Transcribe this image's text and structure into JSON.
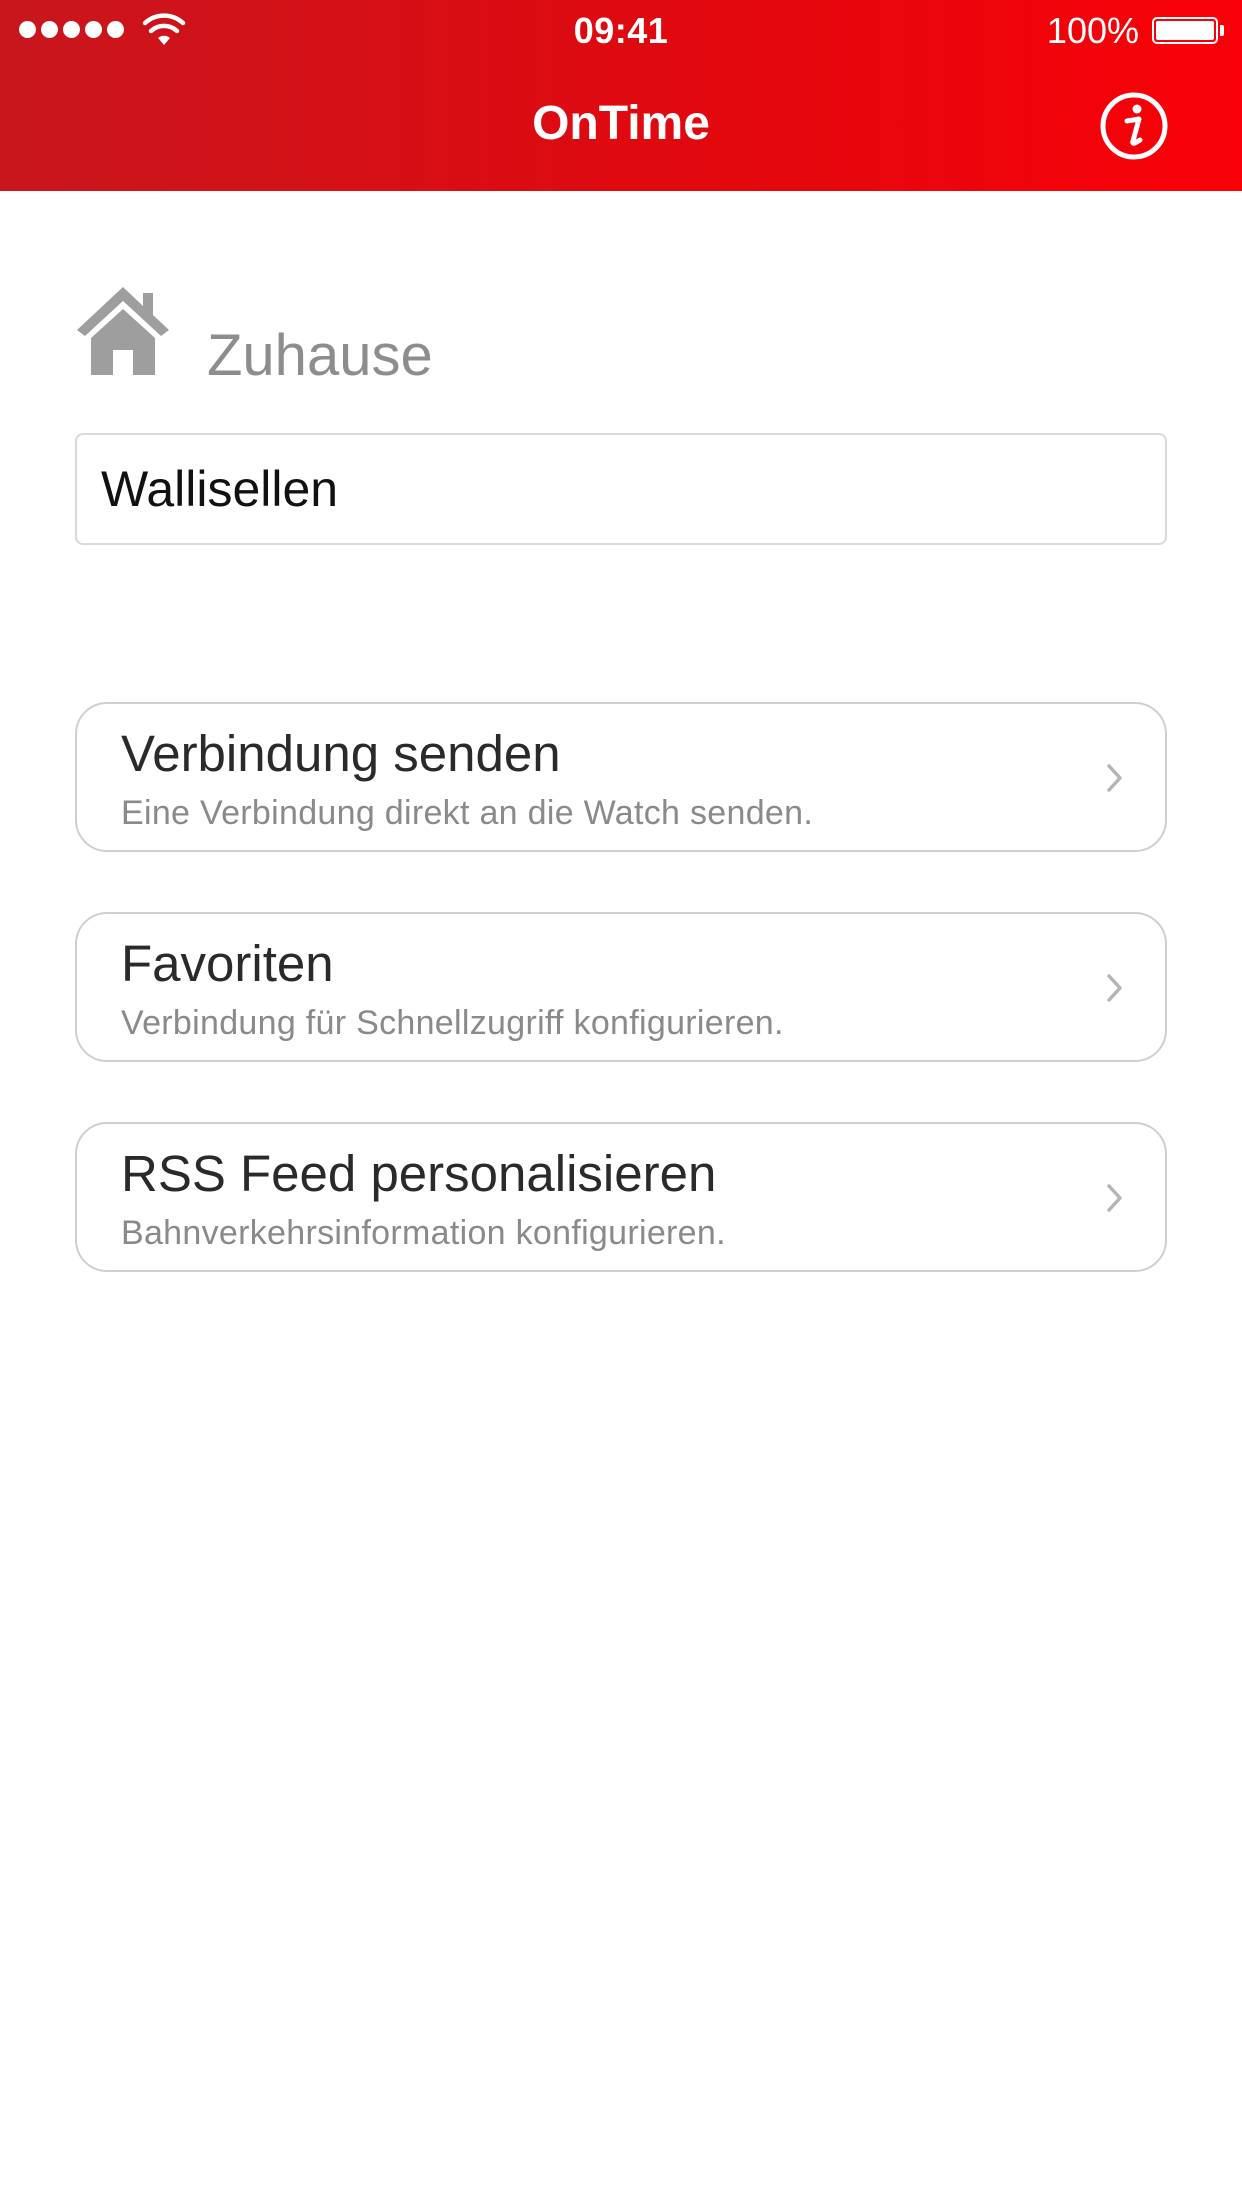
{
  "status_bar": {
    "time": "09:41",
    "battery_percent": "100%",
    "signal_bars": 5
  },
  "nav": {
    "title": "OnTime",
    "info_icon": "info-icon",
    "accent_color": "#e0090f"
  },
  "home": {
    "label": "Zuhause",
    "icon": "home-icon",
    "input_value": "Wallisellen"
  },
  "menu": {
    "items": [
      {
        "title": "Verbindung senden",
        "subtitle": "Eine Verbindung direkt an die Watch senden."
      },
      {
        "title": "Favoriten",
        "subtitle": "Verbindung für Schnellzugriff konfigurieren."
      },
      {
        "title": "RSS Feed personalisieren",
        "subtitle": "Bahnverkehrsinformation konfigurieren."
      }
    ]
  }
}
